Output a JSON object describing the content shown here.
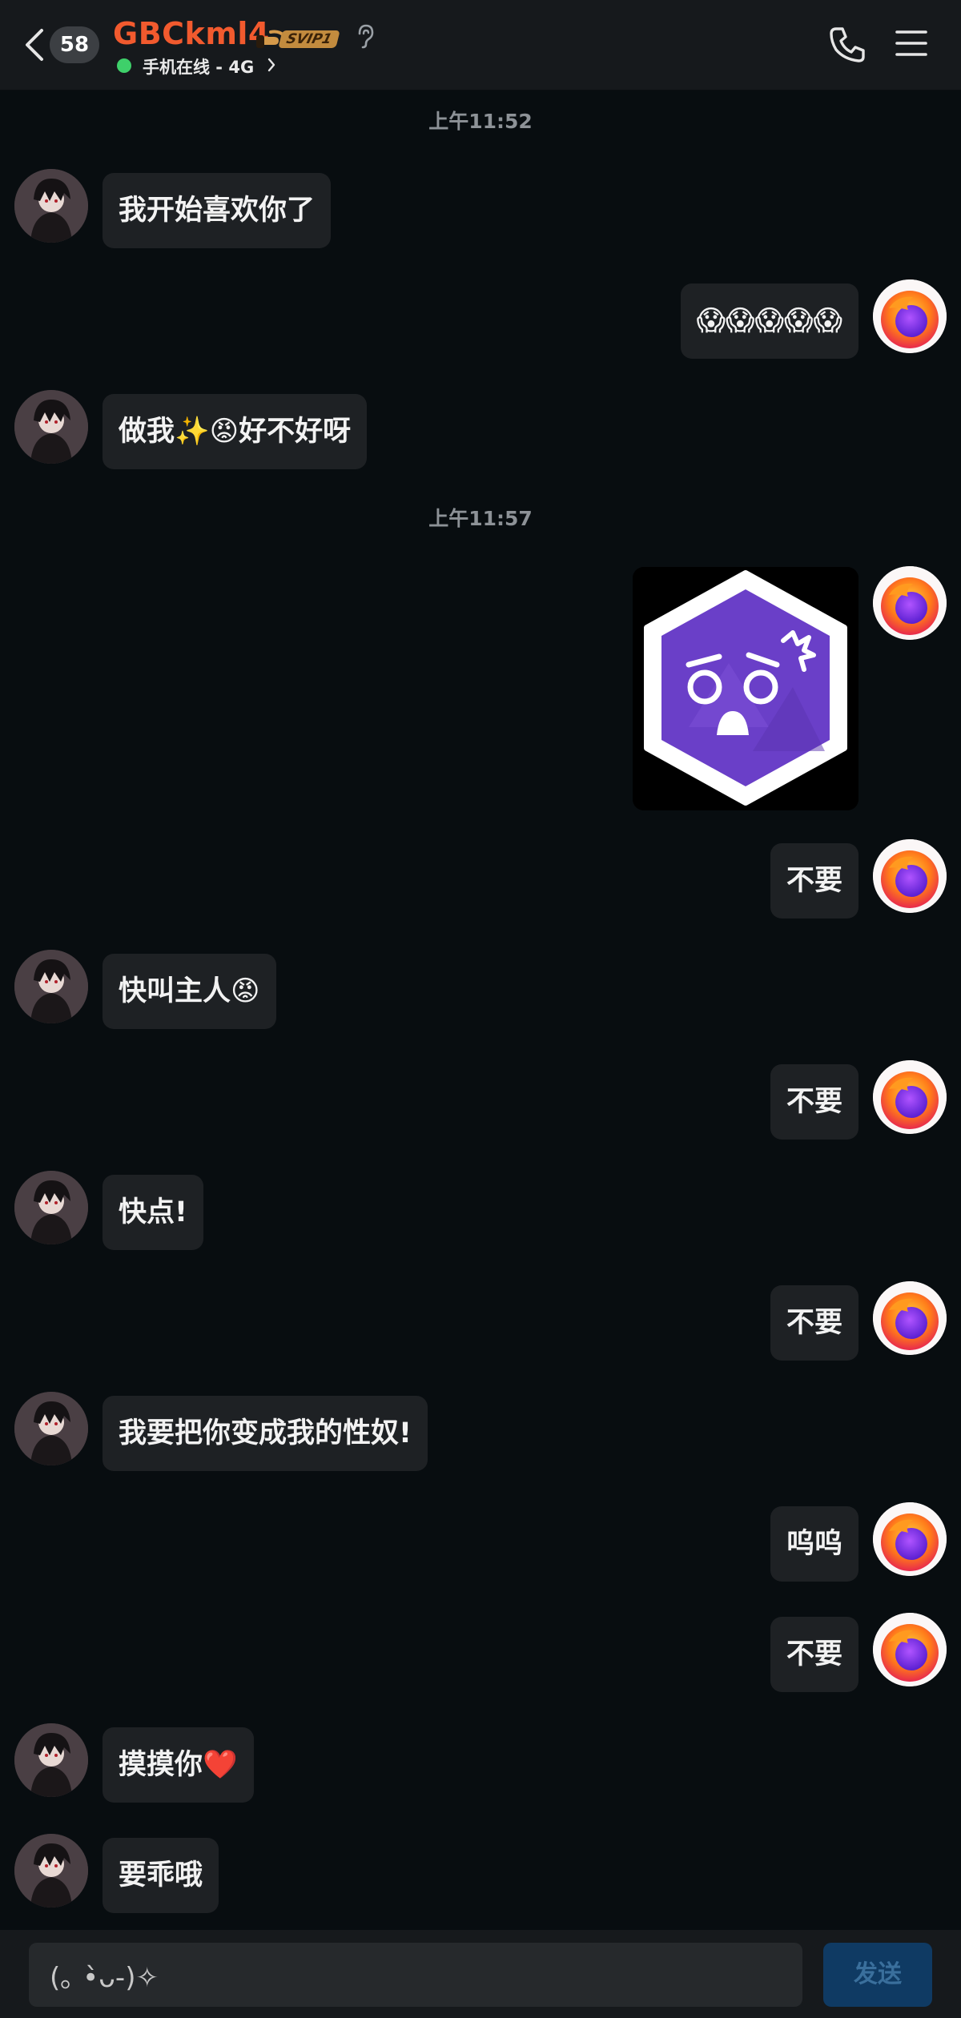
{
  "header": {
    "unread_count": "58",
    "contact_name": "GBCkml4",
    "vip_label": "SVIP1",
    "status_text": "手机在线 - 4G",
    "icons": [
      "back-arrow-icon",
      "ear-icon",
      "chevron-right-icon",
      "phone-icon",
      "menu-icon"
    ]
  },
  "timestamps": [
    "上午11:52",
    "上午11:57"
  ],
  "messages": [
    {
      "side": "left",
      "text": "我开始喜欢你了"
    },
    {
      "side": "right",
      "text": "😱😱😱😱😱"
    },
    {
      "side": "left",
      "text": "做我✨😡好不好呀"
    },
    {
      "side": "right",
      "type": "sticker",
      "sticker": "shocked-face-hexagon-sticker"
    },
    {
      "side": "right",
      "text": "不要"
    },
    {
      "side": "left",
      "text": "快叫主人😡"
    },
    {
      "side": "right",
      "text": "不要"
    },
    {
      "side": "left",
      "text": "快点!"
    },
    {
      "side": "right",
      "text": "不要"
    },
    {
      "side": "left",
      "text": "我要把你变成我的性奴!"
    },
    {
      "side": "right",
      "text": "呜呜"
    },
    {
      "side": "right",
      "text": "不要"
    },
    {
      "side": "left",
      "text": "摸摸你❤️"
    },
    {
      "side": "left",
      "text": "要乖哦"
    }
  ],
  "input": {
    "value": "(｡ •̀ᴗ-)✧",
    "send_label": "发送"
  },
  "colors": {
    "background": "#080d10",
    "header": "#16191c",
    "bubble": "#1e2124",
    "contact_name": "#f25a2e",
    "online": "#3ed06a",
    "send_button": "#0f3a63"
  }
}
